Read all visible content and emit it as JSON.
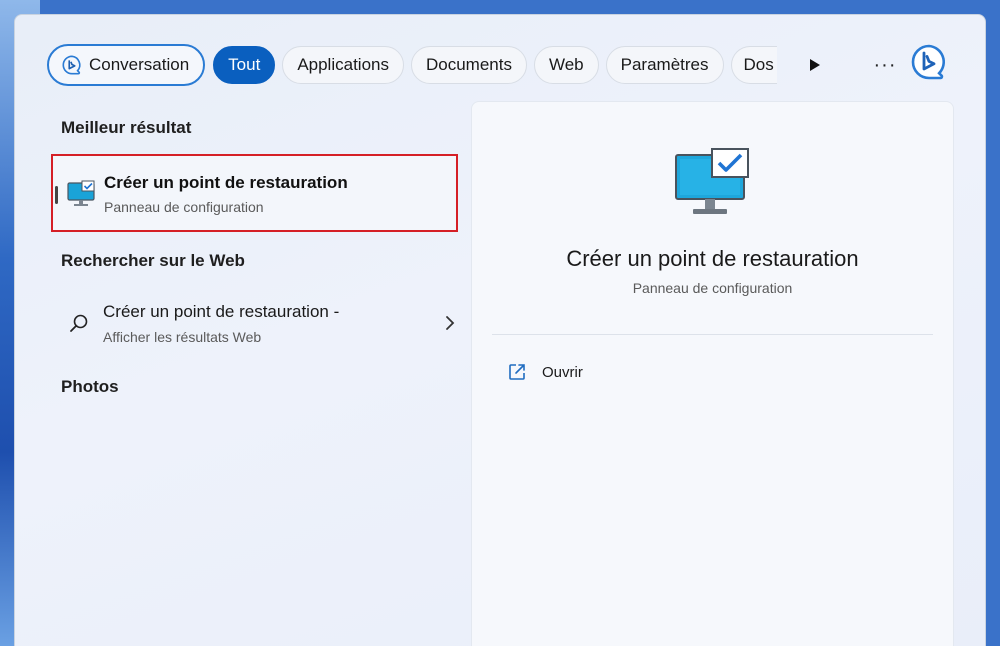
{
  "tabs": [
    {
      "label": "Conversation",
      "state": "bing"
    },
    {
      "label": "Tout",
      "state": "active"
    },
    {
      "label": "Applications",
      "state": "normal"
    },
    {
      "label": "Documents",
      "state": "normal"
    },
    {
      "label": "Web",
      "state": "normal"
    },
    {
      "label": "Paramètres",
      "state": "normal"
    },
    {
      "label": "Dos",
      "state": "clipped"
    }
  ],
  "tab_overflow_glyph": "···",
  "sections": {
    "best": "Meilleur résultat",
    "web": "Rechercher sur le Web",
    "photos": "Photos"
  },
  "best_result": {
    "title": "Créer un point de restauration",
    "subtitle": "Panneau de configuration",
    "icon": "monitor-checkbox-icon",
    "highlight_color": "#d51f26"
  },
  "web_result": {
    "title": "Créer un point de restauration -",
    "subtitle": "Afficher les résultats Web",
    "icon": "search-icon"
  },
  "preview": {
    "title": "Créer un point de restauration",
    "subtitle": "Panneau de configuration",
    "actions": [
      {
        "label": "Ouvrir",
        "icon": "open-external-icon"
      }
    ]
  },
  "colors": {
    "accent": "#0a5fbf",
    "bing": "#2a7bd4"
  }
}
